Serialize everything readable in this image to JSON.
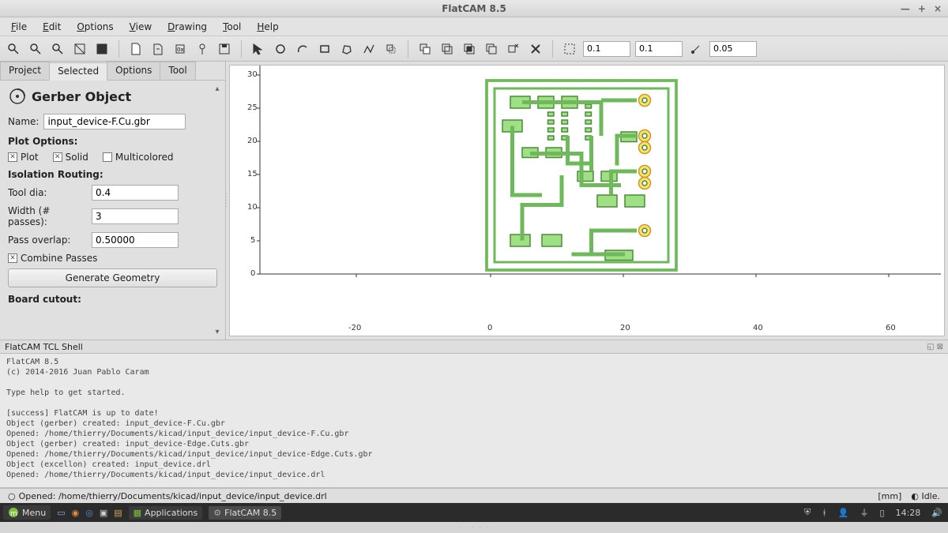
{
  "window": {
    "title": "FlatCAM 8.5"
  },
  "menus": {
    "file": "File",
    "edit": "Edit",
    "options": "Options",
    "view": "View",
    "drawing": "Drawing",
    "tool": "Tool",
    "help": "Help"
  },
  "toolbar": {
    "snap1": "0.1",
    "snap2": "0.1",
    "snap3": "0.05"
  },
  "tabs": {
    "project": "Project",
    "selected": "Selected",
    "options": "Options",
    "tool": "Tool"
  },
  "panel": {
    "heading": "Gerber Object",
    "name_label": "Name:",
    "name_value": "input_device-F.Cu.gbr",
    "plot_options_label": "Plot Options:",
    "plot": "Plot",
    "solid": "Solid",
    "multicolored": "Multicolored",
    "iso_label": "Isolation Routing:",
    "tool_dia_label": "Tool dia:",
    "tool_dia_value": "0.4",
    "width_label": "Width (# passes):",
    "width_value": "3",
    "overlap_label": "Pass overlap:",
    "overlap_value": "0.50000",
    "combine": "Combine Passes",
    "generate": "Generate Geometry",
    "cutout_label": "Board cutout:"
  },
  "axes": {
    "y": [
      "30",
      "25",
      "20",
      "15",
      "10",
      "5",
      "0"
    ],
    "x": [
      "-20",
      "0",
      "20",
      "40",
      "60"
    ]
  },
  "shell": {
    "title": "FlatCAM TCL Shell",
    "text": "FlatCAM 8.5\n(c) 2014-2016 Juan Pablo Caram\n\nType help to get started.\n\n[success] FlatCAM is up to date!\nObject (gerber) created: input_device-F.Cu.gbr\nOpened: /home/thierry/Documents/kicad/input_device/input_device-F.Cu.gbr\nObject (gerber) created: input_device-Edge.Cuts.gbr\nOpened: /home/thierry/Documents/kicad/input_device/input_device-Edge.Cuts.gbr\nObject (excellon) created: input_device.drl\nOpened: /home/thierry/Documents/kicad/input_device/input_device.drl"
  },
  "status": {
    "left_icon": "○",
    "left": "Opened: /home/thierry/Documents/kicad/input_device/input_device.drl",
    "units": "[mm]",
    "state": "Idle."
  },
  "taskbar": {
    "menu": "Menu",
    "apps": "Applications",
    "active": "FlatCAM 8.5",
    "time": "14:28"
  }
}
